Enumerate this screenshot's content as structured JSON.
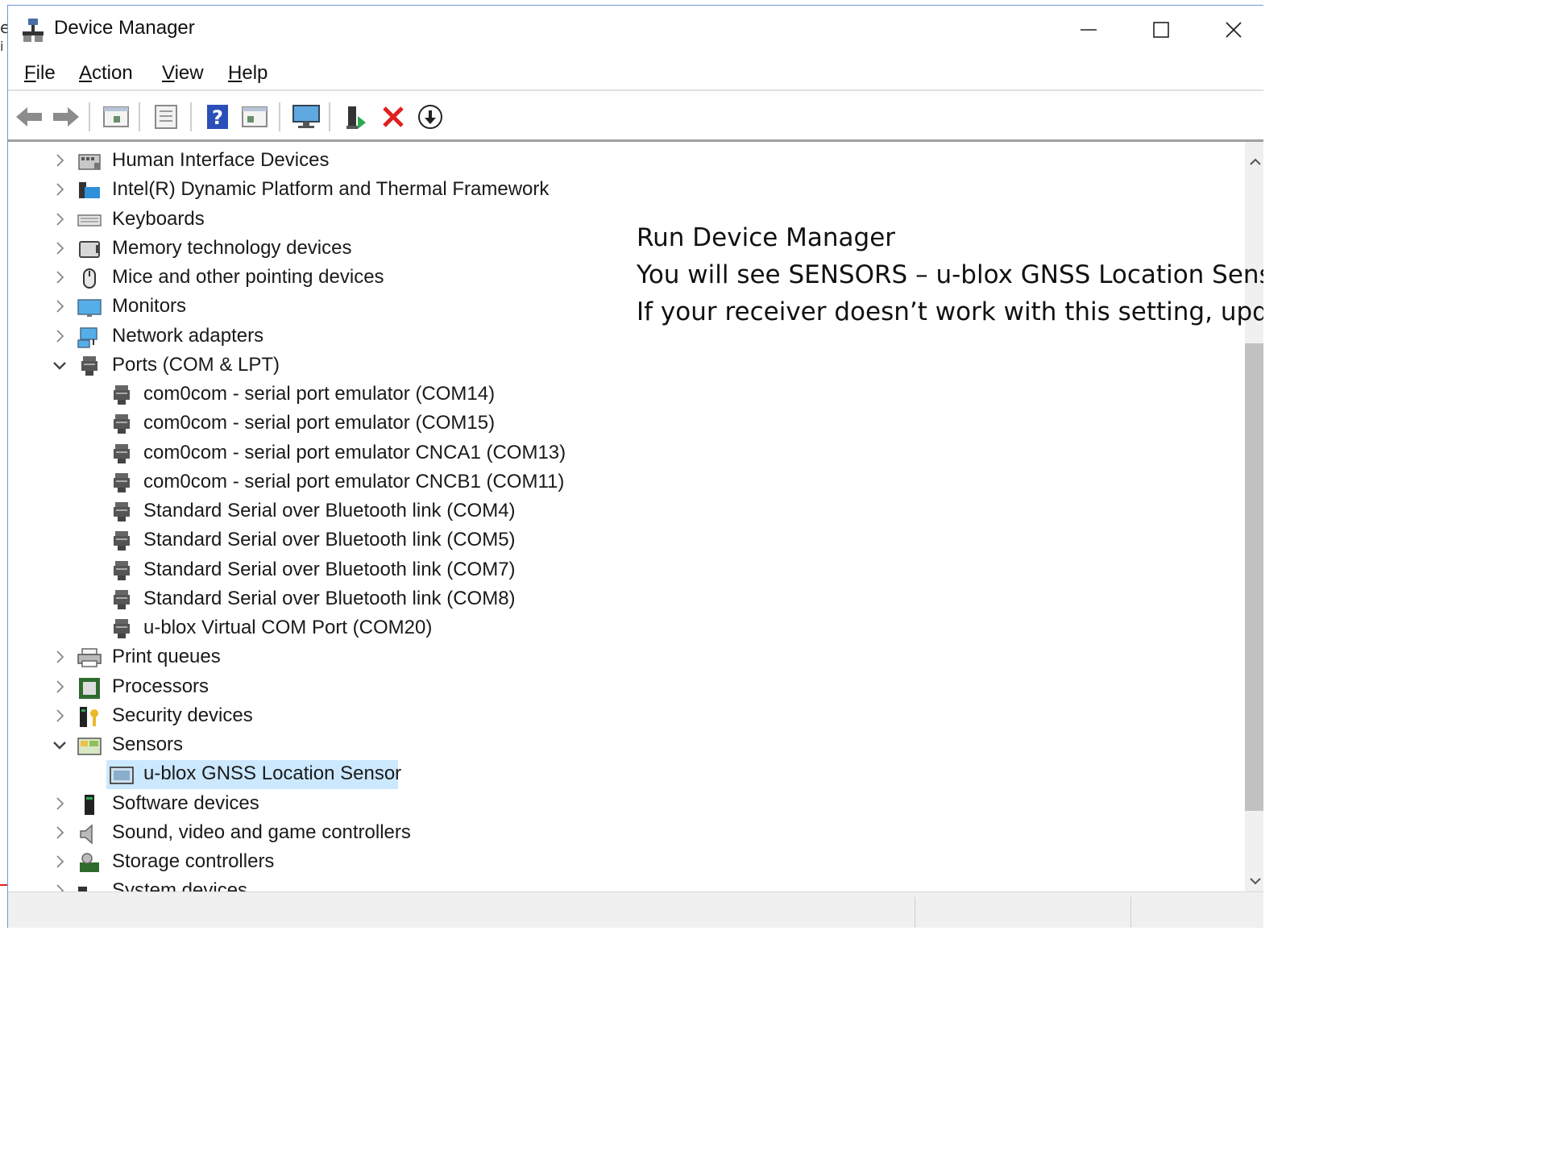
{
  "window": {
    "title": "Device Manager",
    "controls": {
      "minimize": "—",
      "maximize": "☐",
      "close": "✕"
    }
  },
  "menu": [
    {
      "accel": "F",
      "rest": "ile"
    },
    {
      "accel": "A",
      "rest": "ction"
    },
    {
      "accel": "V",
      "rest": "iew"
    },
    {
      "accel": "H",
      "rest": "elp"
    }
  ],
  "tree": {
    "items": [
      {
        "label": "Human Interface Devices",
        "icon": "hid-icon",
        "expanded": false
      },
      {
        "label": "Intel(R) Dynamic Platform and Thermal Framework",
        "icon": "intel-icon",
        "expanded": false
      },
      {
        "label": "Keyboards",
        "icon": "keyboard-icon",
        "expanded": false
      },
      {
        "label": "Memory technology devices",
        "icon": "memory-icon",
        "expanded": false
      },
      {
        "label": "Mice and other pointing devices",
        "icon": "mouse-icon",
        "expanded": false
      },
      {
        "label": "Monitors",
        "icon": "monitor-icon",
        "expanded": false
      },
      {
        "label": "Network adapters",
        "icon": "network-icon",
        "expanded": false
      },
      {
        "label": "Ports (COM & LPT)",
        "icon": "port-icon",
        "expanded": true
      },
      {
        "label": "com0com - serial port emulator (COM14)",
        "icon": "port-icon",
        "child": true
      },
      {
        "label": "com0com - serial port emulator (COM15)",
        "icon": "port-icon",
        "child": true
      },
      {
        "label": "com0com - serial port emulator CNCA1 (COM13)",
        "icon": "port-icon",
        "child": true
      },
      {
        "label": "com0com - serial port emulator CNCB1 (COM11)",
        "icon": "port-icon",
        "child": true
      },
      {
        "label": "Standard Serial over Bluetooth link (COM4)",
        "icon": "port-icon",
        "child": true
      },
      {
        "label": "Standard Serial over Bluetooth link (COM5)",
        "icon": "port-icon",
        "child": true
      },
      {
        "label": "Standard Serial over Bluetooth link (COM7)",
        "icon": "port-icon",
        "child": true
      },
      {
        "label": "Standard Serial over Bluetooth link (COM8)",
        "icon": "port-icon",
        "child": true
      },
      {
        "label": "u-blox Virtual COM Port (COM20)",
        "icon": "port-icon",
        "child": true
      },
      {
        "label": "Print queues",
        "icon": "printer-icon",
        "expanded": false
      },
      {
        "label": "Processors",
        "icon": "processor-icon",
        "expanded": false
      },
      {
        "label": "Security devices",
        "icon": "security-icon",
        "expanded": false
      },
      {
        "label": "Sensors",
        "icon": "sensor-icon",
        "expanded": true
      },
      {
        "label": "u-blox GNSS Location Sensor",
        "icon": "sensor-device-icon",
        "child": true,
        "selected": true
      },
      {
        "label": "Software devices",
        "icon": "software-icon",
        "expanded": false
      },
      {
        "label": "Sound, video and game controllers",
        "icon": "speaker-icon",
        "expanded": false
      },
      {
        "label": "Storage controllers",
        "icon": "storage-icon",
        "expanded": false
      },
      {
        "label": "System devices",
        "icon": "system-icon",
        "expanded": false
      }
    ]
  },
  "annotation": {
    "line1": "Run Device Manager",
    "line2": "You will see SENSORS – u-blox GNSS Location Sensor",
    "line3": "If your receiver doesn’t work with this setting, update"
  },
  "edge_chars": {
    "top": "e",
    "second": "i"
  },
  "colors": {
    "selection": "#cce8ff",
    "border": "#6a9bd8",
    "delete": "#e02020"
  }
}
